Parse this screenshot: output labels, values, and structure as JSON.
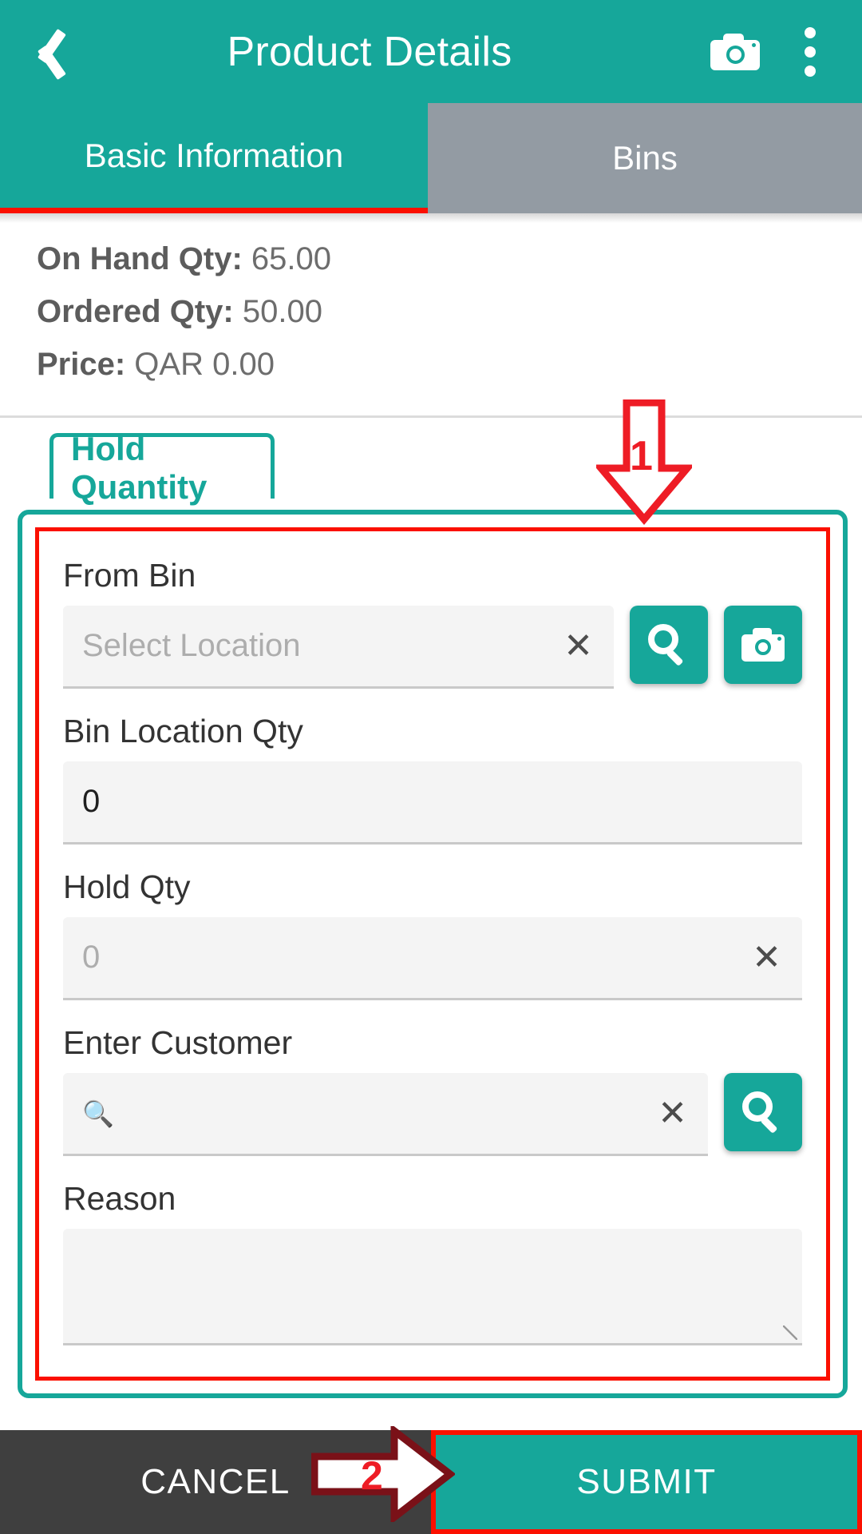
{
  "appbar": {
    "title": "Product Details",
    "back_icon": "back-chevron-icon",
    "camera_icon": "camera-icon",
    "overflow_icon": "more-vertical-icon"
  },
  "tabs": [
    {
      "label": "Basic Information",
      "active": true
    },
    {
      "label": "Bins",
      "active": false
    }
  ],
  "info": {
    "on_hand_label": "On Hand Qty:",
    "on_hand_value": "65.00",
    "ordered_label": "Ordered Qty:",
    "ordered_value": "50.00",
    "price_label": "Price:",
    "price_value": "QAR 0.00"
  },
  "section": {
    "hold_quantity_tab": "Hold Quantity"
  },
  "form": {
    "from_bin": {
      "label": "From Bin",
      "placeholder": "Select Location",
      "value": "",
      "clear_icon": "close-x-icon",
      "search_button_icon": "search-icon",
      "camera_button_icon": "camera-icon"
    },
    "bin_location_qty": {
      "label": "Bin Location Qty",
      "value": "0"
    },
    "hold_qty": {
      "label": "Hold Qty",
      "placeholder": "0",
      "value": "",
      "clear_icon": "close-x-icon"
    },
    "enter_customer": {
      "label": "Enter Customer",
      "placeholder": "",
      "value": "",
      "inline_search_icon": "search-icon",
      "clear_icon": "close-x-icon",
      "search_button_icon": "search-icon"
    },
    "reason": {
      "label": "Reason",
      "value": "",
      "resize_handle": "resize-grip-icon"
    }
  },
  "bottom_bar": {
    "cancel_label": "CANCEL",
    "submit_label": "SUBMIT"
  },
  "annotations": {
    "step_1": "1",
    "step_2": "2"
  },
  "colors": {
    "primary_teal": "#16a79a",
    "annotation_red": "#fb1000",
    "inactive_tab_gray": "#939ba3",
    "cancel_dark": "#3f3f3f",
    "field_fill": "#f4f4f4"
  }
}
